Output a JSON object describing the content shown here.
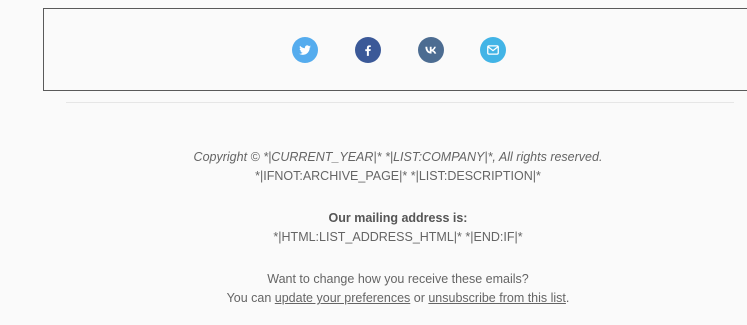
{
  "social": {
    "icons": [
      {
        "name": "twitter",
        "color": "#55acee"
      },
      {
        "name": "facebook",
        "color": "#3b5998"
      },
      {
        "name": "vk",
        "color": "#4c6c91"
      },
      {
        "name": "email",
        "color": "#42b4e6"
      }
    ]
  },
  "footer": {
    "copyright": "Copyright © *|CURRENT_YEAR|* *|LIST:COMPANY|*, All rights reserved.",
    "description": "*|IFNOT:ARCHIVE_PAGE|* *|LIST:DESCRIPTION|*",
    "mailing_heading": "Our mailing address is:",
    "mailing_address": "*|HTML:LIST_ADDRESS_HTML|* *|END:IF|*",
    "change_question": "Want to change how you receive these emails?",
    "you_can": "You can ",
    "update_prefs_link": "update your preferences",
    "or_text": " or ",
    "unsubscribe_link": "unsubscribe from this list",
    "period": "."
  }
}
